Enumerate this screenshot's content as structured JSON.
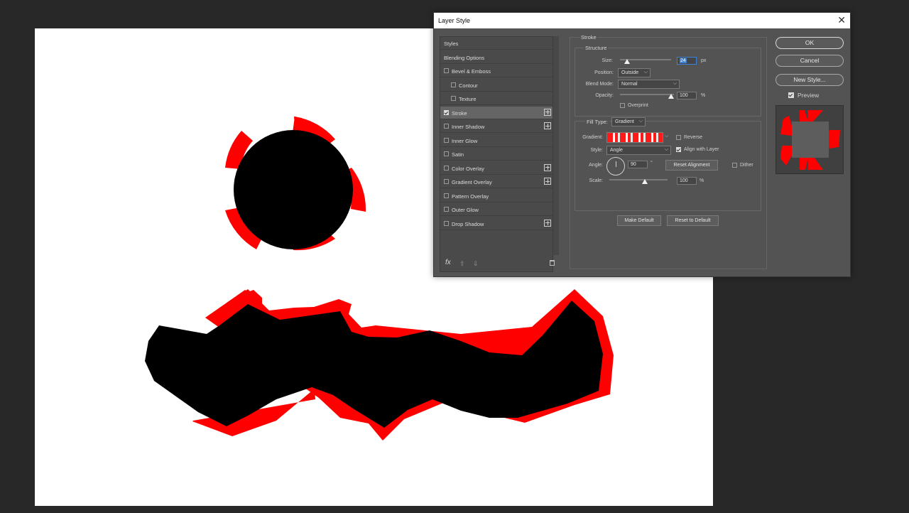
{
  "dialog": {
    "title": "Layer Style",
    "close_glyph": "✕",
    "styles_list": [
      {
        "label": "Styles",
        "has_checkbox": false,
        "checked": false,
        "plus": false,
        "indent": 0
      },
      {
        "label": "Blending Options",
        "has_checkbox": false,
        "checked": false,
        "plus": false,
        "indent": 0
      },
      {
        "label": "Bevel & Emboss",
        "has_checkbox": true,
        "checked": false,
        "plus": false,
        "indent": 0
      },
      {
        "label": "Contour",
        "has_checkbox": true,
        "checked": false,
        "plus": false,
        "indent": 1
      },
      {
        "label": "Texture",
        "has_checkbox": true,
        "checked": false,
        "plus": false,
        "indent": 1
      },
      {
        "label": "Stroke",
        "has_checkbox": true,
        "checked": true,
        "plus": true,
        "indent": 0,
        "selected": true
      },
      {
        "label": "Inner Shadow",
        "has_checkbox": true,
        "checked": false,
        "plus": true,
        "indent": 0
      },
      {
        "label": "Inner Glow",
        "has_checkbox": true,
        "checked": false,
        "plus": false,
        "indent": 0
      },
      {
        "label": "Satin",
        "has_checkbox": true,
        "checked": false,
        "plus": false,
        "indent": 0
      },
      {
        "label": "Color Overlay",
        "has_checkbox": true,
        "checked": false,
        "plus": true,
        "indent": 0
      },
      {
        "label": "Gradient Overlay",
        "has_checkbox": true,
        "checked": false,
        "plus": true,
        "indent": 0
      },
      {
        "label": "Pattern Overlay",
        "has_checkbox": true,
        "checked": false,
        "plus": false,
        "indent": 0
      },
      {
        "label": "Outer Glow",
        "has_checkbox": true,
        "checked": false,
        "plus": false,
        "indent": 0
      },
      {
        "label": "Drop Shadow",
        "has_checkbox": true,
        "checked": false,
        "plus": true,
        "indent": 0
      }
    ],
    "footer": {
      "fx": "fx",
      "up_glyph": "⇧",
      "down_glyph": "⇩"
    },
    "stroke": {
      "panel_title": "Stroke",
      "structure_title": "Structure",
      "size_label": "Size:",
      "size_value": "24",
      "size_unit": "px",
      "position_label": "Position:",
      "position_value": "Outside",
      "blend_label": "Blend Mode:",
      "blend_value": "Normal",
      "opacity_label": "Opacity:",
      "opacity_value": "100",
      "opacity_unit": "%",
      "overprint_label": "Overprint",
      "filltype_label": "Fill Type:",
      "filltype_value": "Gradient",
      "gradient_label": "Gradient:",
      "reverse_label": "Reverse",
      "style_label": "Style:",
      "style_value": "Angle",
      "align_label": "Align with Layer",
      "angle_label": "Angle:",
      "angle_value": "90",
      "angle_unit": "°",
      "reset_alignment": "Reset Alignment",
      "dither_label": "Dither",
      "scale_label": "Scale:",
      "scale_value": "100",
      "scale_unit": "%",
      "make_default": "Make Default",
      "reset_default": "Reset to Default"
    },
    "buttons": {
      "ok": "OK",
      "cancel": "Cancel",
      "new_style": "New Style...",
      "preview_label": "Preview"
    },
    "chevron": "⌵"
  },
  "colors": {
    "stroke_red": "#ff0000",
    "shape_black": "#000000",
    "canvas": "#ffffff",
    "workspace": "#282828"
  }
}
